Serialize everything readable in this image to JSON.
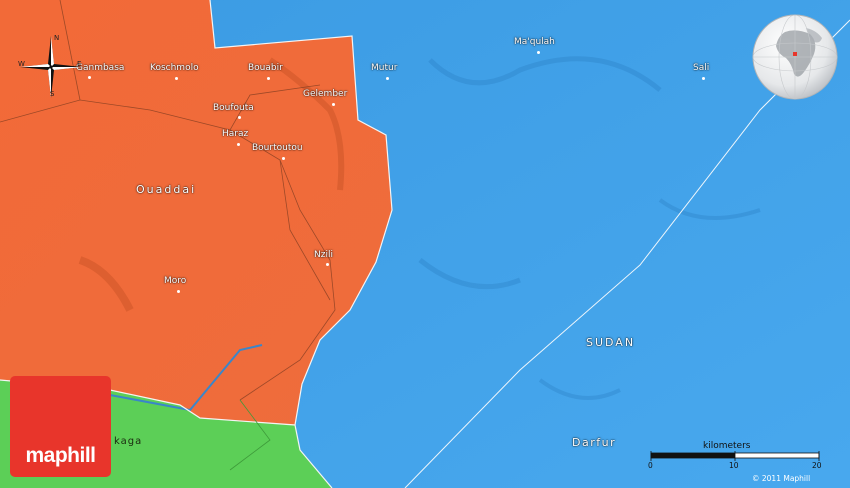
{
  "map": {
    "country_label": "SUDAN",
    "region_labels": {
      "ouaddai": "Ouaddai",
      "darfur": "Darfur",
      "akaga": "kaga"
    },
    "places": [
      {
        "name": "Ganmbasa",
        "key": "ganmbasa"
      },
      {
        "name": "Koschmolo",
        "key": "koschmolo"
      },
      {
        "name": "Bouabir",
        "key": "bouabir"
      },
      {
        "name": "Gelember",
        "key": "gelember"
      },
      {
        "name": "Boufouta",
        "key": "boufouta"
      },
      {
        "name": "Haraz",
        "key": "haraz"
      },
      {
        "name": "Bourtoutou",
        "key": "bourtoutou"
      },
      {
        "name": "Nzili",
        "key": "nzili"
      },
      {
        "name": "Moro",
        "key": "moro"
      },
      {
        "name": "Mutur",
        "key": "mutur"
      },
      {
        "name": "Ma'qulah",
        "key": "maqulah"
      },
      {
        "name": "Sali",
        "key": "sali"
      }
    ],
    "colors": {
      "chad": "#f06a3a",
      "sudan": "#40a2e8",
      "car": "#5fd35a",
      "border": "#f4f4f4"
    }
  },
  "compass": {
    "n": "N",
    "s": "S",
    "e": "E",
    "w": "W"
  },
  "scale": {
    "title": "kilometers",
    "ticks": [
      "0",
      "10",
      "20"
    ]
  },
  "logo": {
    "text": "maphill"
  },
  "copyright": "© 2011 Maphill",
  "globe": {
    "icon": "globe-icon"
  }
}
